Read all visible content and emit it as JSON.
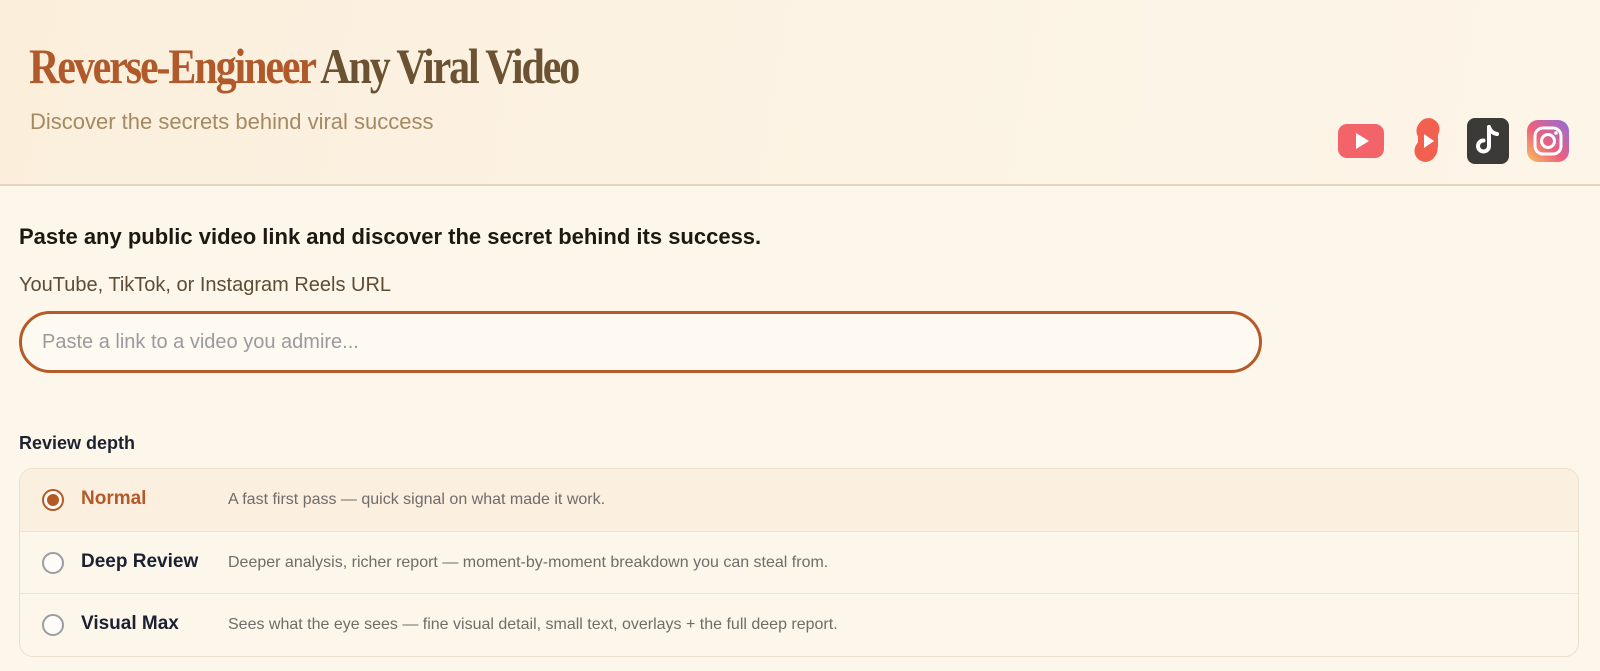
{
  "header": {
    "title_accent": "Reverse-Engineer",
    "title_rest": "Any Viral Video",
    "subtitle": "Discover the secrets behind viral success",
    "platforms": [
      {
        "name": "YouTube",
        "icon": "youtube-icon"
      },
      {
        "name": "YouTube Shorts",
        "icon": "youtube-shorts-icon"
      },
      {
        "name": "TikTok",
        "icon": "tiktok-icon"
      },
      {
        "name": "Instagram",
        "icon": "instagram-icon"
      }
    ]
  },
  "form": {
    "lead": "Paste any public video link and discover the secret behind its success.",
    "url_label": "YouTube, TikTok, or Instagram Reels URL",
    "url_value": "",
    "url_placeholder": "Paste a link to a video you admire..."
  },
  "depth": {
    "title": "Review depth",
    "selected": "Normal",
    "options": [
      {
        "name": "Normal",
        "description": "A fast first pass — quick signal on what made it work."
      },
      {
        "name": "Deep Review",
        "description": "Deeper analysis, richer report — moment-by-moment breakdown you can steal from."
      },
      {
        "name": "Visual Max",
        "description": "Sees what the eye sees — fine visual detail, small text, overlays + the full deep report."
      }
    ]
  },
  "colors": {
    "accent": "#b55a27",
    "title_dark": "#6b5232",
    "background": "#fdf6ea",
    "youtube_red": "#f2636a",
    "tiktok_dark": "#3b3a37"
  }
}
